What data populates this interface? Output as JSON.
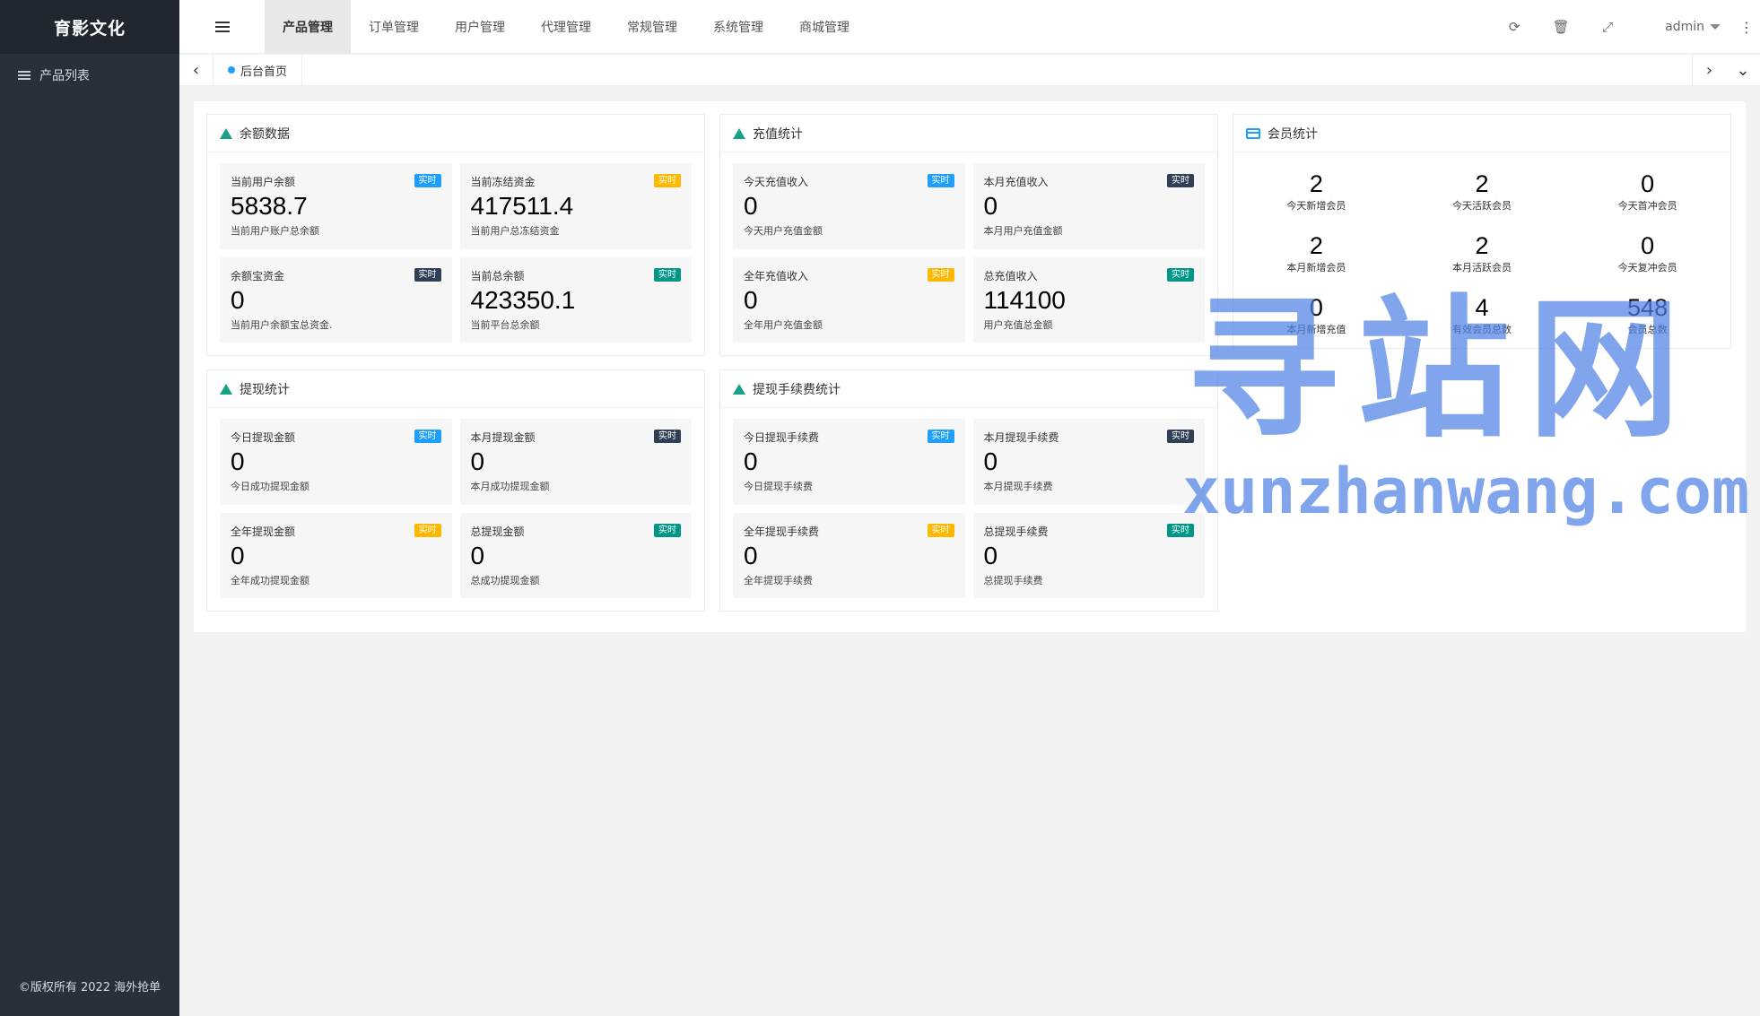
{
  "sidebar": {
    "brand": "育影文化",
    "items": [
      {
        "label": "产品列表",
        "icon": "list-icon"
      }
    ],
    "copyright": "©版权所有 2022 海外抢单"
  },
  "topbar": {
    "tabs": [
      {
        "label": "产品管理",
        "active": true
      },
      {
        "label": "订单管理"
      },
      {
        "label": "用户管理"
      },
      {
        "label": "代理管理"
      },
      {
        "label": "常规管理"
      },
      {
        "label": "系统管理"
      },
      {
        "label": "商城管理"
      }
    ],
    "user": "admin"
  },
  "tabstrip": {
    "current": "后台首页"
  },
  "panels": {
    "balance": {
      "title": "余额数据",
      "stats": [
        {
          "label": "当前用户余额",
          "value": "5838.7",
          "desc": "当前用户账户总余额",
          "badge": "实时",
          "badge_color": "#1e9fff"
        },
        {
          "label": "当前冻结资金",
          "value": "417511.4",
          "desc": "当前用户总冻结资金",
          "badge": "实时",
          "badge_color": "#ffb800"
        },
        {
          "label": "余额宝资金",
          "value": "0",
          "desc": "当前用户余额宝总资金.",
          "badge": "实时",
          "badge_color": "#2f4056"
        },
        {
          "label": "当前总余额",
          "value": "423350.1",
          "desc": "当前平台总余额",
          "badge": "实时",
          "badge_color": "#009688"
        }
      ]
    },
    "recharge": {
      "title": "充值统计",
      "stats": [
        {
          "label": "今天充值收入",
          "value": "0",
          "desc": "今天用户充值金额",
          "badge": "实时",
          "badge_color": "#1e9fff"
        },
        {
          "label": "本月充值收入",
          "value": "0",
          "desc": "本月用户充值金额",
          "badge": "实时",
          "badge_color": "#2f4056"
        },
        {
          "label": "全年充值收入",
          "value": "0",
          "desc": "全年用户充值金额",
          "badge": "实时",
          "badge_color": "#ffb800"
        },
        {
          "label": "总充值收入",
          "value": "114100",
          "desc": "用户充值总金额",
          "badge": "实时",
          "badge_color": "#009688"
        }
      ]
    },
    "members": {
      "title": "会员统计",
      "stats": [
        {
          "value": "2",
          "label": "今天新增会员"
        },
        {
          "value": "2",
          "label": "今天活跃会员"
        },
        {
          "value": "0",
          "label": "今天首冲会员"
        },
        {
          "value": "2",
          "label": "本月新增会员"
        },
        {
          "value": "2",
          "label": "本月活跃会员"
        },
        {
          "value": "0",
          "label": "今天复冲会员"
        },
        {
          "value": "0",
          "label": "本月新增充值"
        },
        {
          "value": "4",
          "label": "有效会员总数"
        },
        {
          "value": "548",
          "label": "会员总数"
        }
      ]
    },
    "withdraw": {
      "title": "提现统计",
      "stats": [
        {
          "label": "今日提现金额",
          "value": "0",
          "desc": "今日成功提现金额",
          "badge": "实时",
          "badge_color": "#1e9fff"
        },
        {
          "label": "本月提现金额",
          "value": "0",
          "desc": "本月成功提现金额",
          "badge": "实时",
          "badge_color": "#2f4056"
        },
        {
          "label": "全年提现金额",
          "value": "0",
          "desc": "全年成功提现金额",
          "badge": "实时",
          "badge_color": "#ffb800"
        },
        {
          "label": "总提现金额",
          "value": "0",
          "desc": "总成功提现金额",
          "badge": "实时",
          "badge_color": "#009688"
        }
      ]
    },
    "fee": {
      "title": "提现手续费统计",
      "stats": [
        {
          "label": "今日提现手续费",
          "value": "0",
          "desc": "今日提现手续费",
          "badge": "实时",
          "badge_color": "#1e9fff"
        },
        {
          "label": "本月提现手续费",
          "value": "0",
          "desc": "本月提现手续费",
          "badge": "实时",
          "badge_color": "#2f4056"
        },
        {
          "label": "全年提现手续费",
          "value": "0",
          "desc": "全年提现手续费",
          "badge": "实时",
          "badge_color": "#ffb800"
        },
        {
          "label": "总提现手续费",
          "value": "0",
          "desc": "总提现手续费",
          "badge": "实时",
          "badge_color": "#009688"
        }
      ]
    }
  },
  "watermark": {
    "cn": "寻站网",
    "en": "xunzhanwang.com"
  }
}
